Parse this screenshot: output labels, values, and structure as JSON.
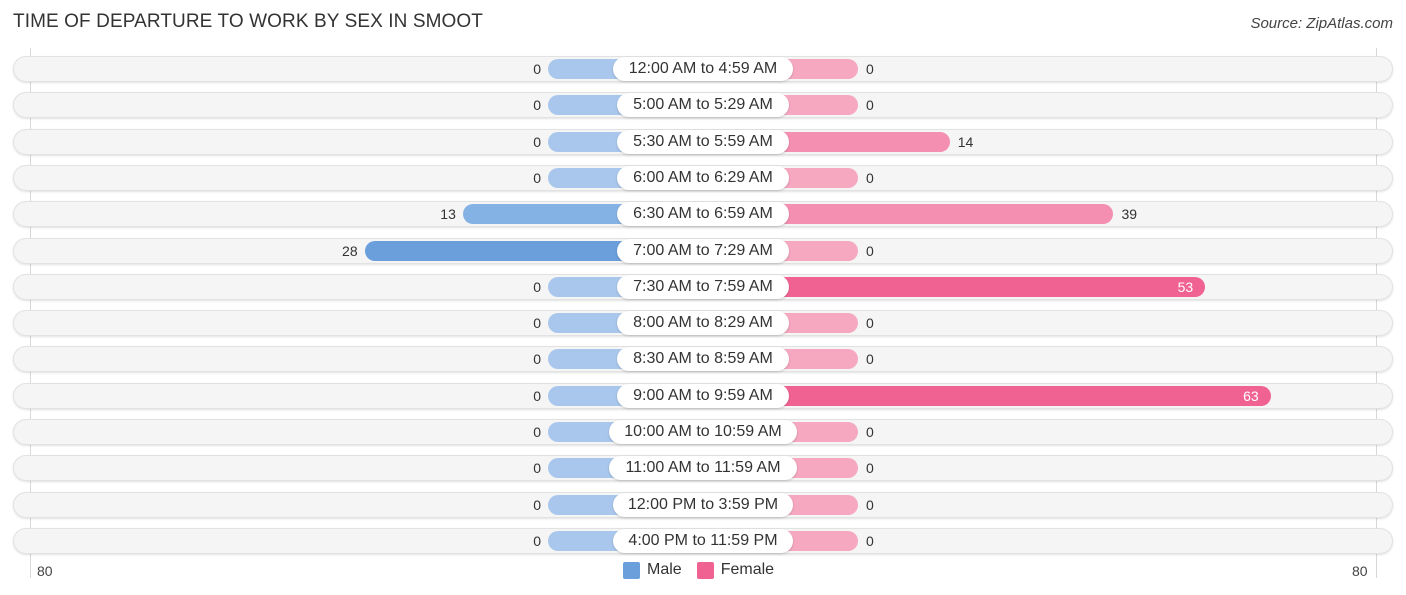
{
  "chart_data": {
    "type": "bar",
    "orientation": "horizontal-diverging",
    "title": "TIME OF DEPARTURE TO WORK BY SEX IN SMOOT",
    "source": "Source: ZipAtlas.com",
    "categories": [
      "12:00 AM to 4:59 AM",
      "5:00 AM to 5:29 AM",
      "5:30 AM to 5:59 AM",
      "6:00 AM to 6:29 AM",
      "6:30 AM to 6:59 AM",
      "7:00 AM to 7:29 AM",
      "7:30 AM to 7:59 AM",
      "8:00 AM to 8:29 AM",
      "8:30 AM to 8:59 AM",
      "9:00 AM to 9:59 AM",
      "10:00 AM to 10:59 AM",
      "11:00 AM to 11:59 AM",
      "12:00 PM to 3:59 PM",
      "4:00 PM to 11:59 PM"
    ],
    "series": [
      {
        "name": "Male",
        "color": "#6a9fdc",
        "light_color": "#a9c7ec",
        "values": [
          0,
          0,
          0,
          0,
          13,
          28,
          0,
          0,
          0,
          0,
          0,
          0,
          0,
          0
        ]
      },
      {
        "name": "Female",
        "color": "#f06292",
        "light_color": "#f5a8c0",
        "values": [
          0,
          0,
          14,
          0,
          39,
          0,
          53,
          0,
          0,
          63,
          0,
          0,
          0,
          0
        ]
      }
    ],
    "axis": {
      "left_label": "80",
      "right_label": "80",
      "range": [
        -80,
        80
      ]
    },
    "legend": {
      "position": "bottom-center",
      "items": [
        "Male",
        "Female"
      ]
    },
    "grid": false
  }
}
